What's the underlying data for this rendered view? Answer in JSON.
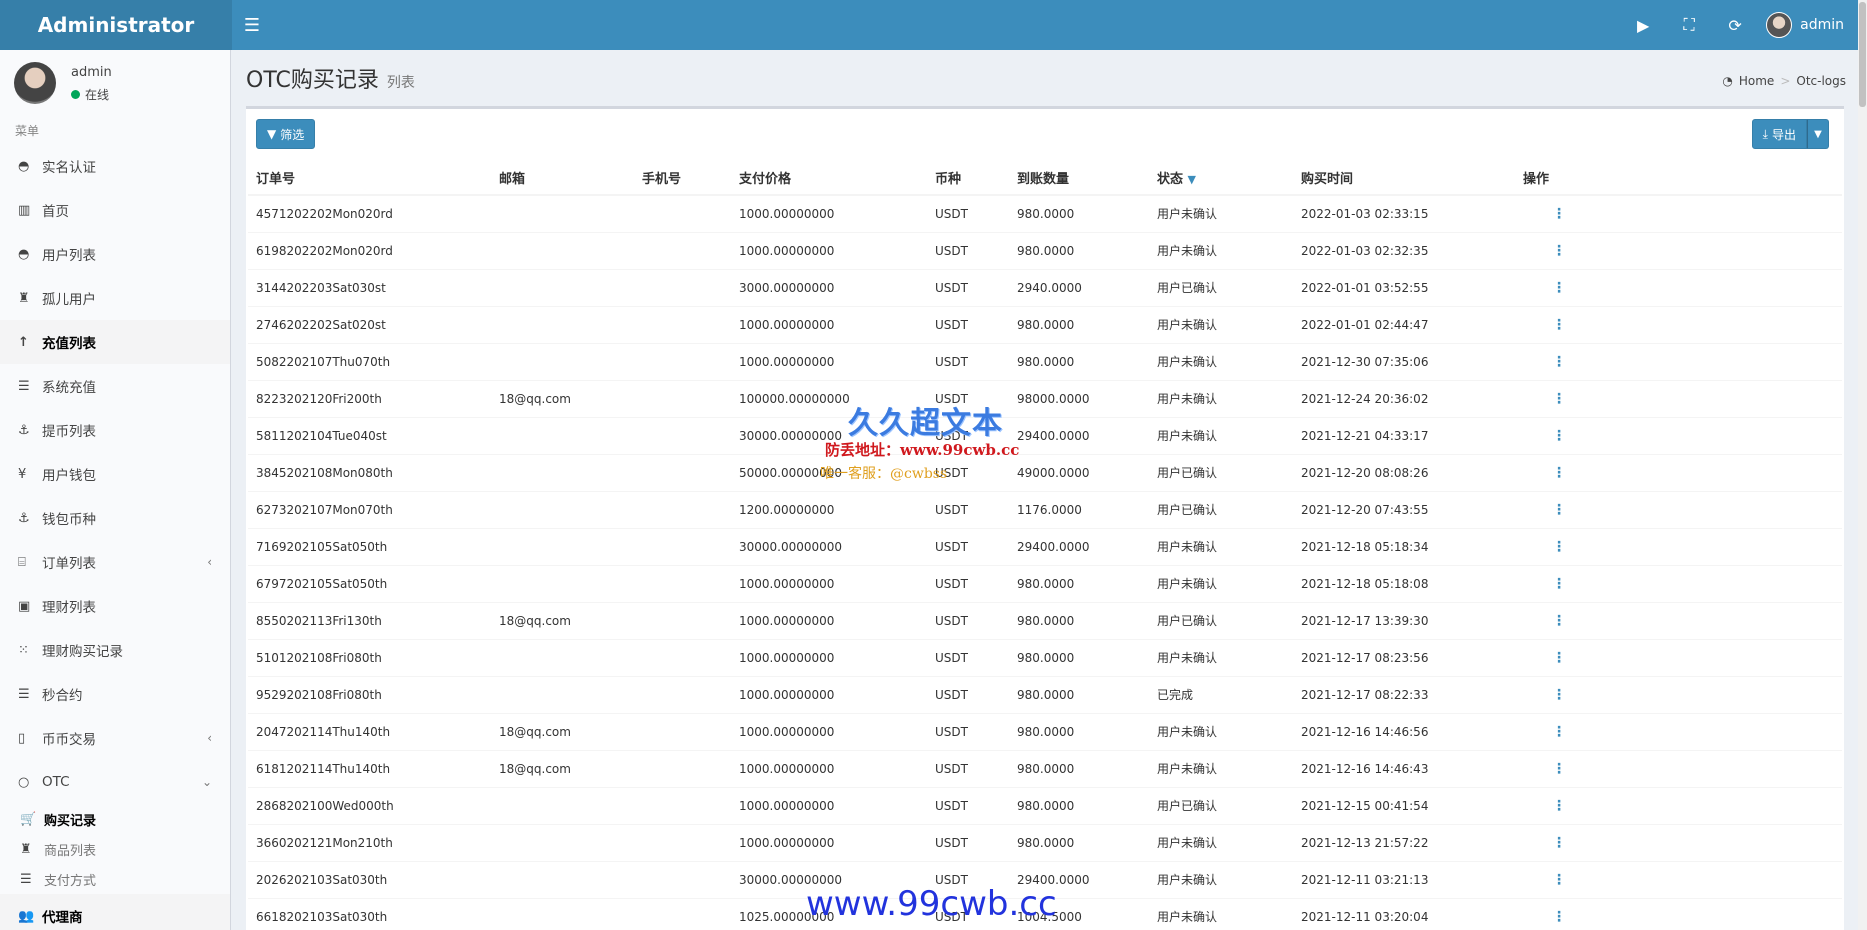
{
  "app": {
    "brand": "Administrator"
  },
  "topbar": {
    "toggle_icon": "menu-icon",
    "user_name": "admin"
  },
  "sidebar": {
    "user": {
      "name": "admin",
      "status": "在线"
    },
    "menu_header": "菜单",
    "items": [
      {
        "label": "实名认证",
        "icon": "◓"
      },
      {
        "label": "首页",
        "icon": "▥"
      },
      {
        "label": "用户列表",
        "icon": "◓"
      },
      {
        "label": "孤儿用户",
        "icon": "♜"
      },
      {
        "label": "充值列表",
        "icon": "↑"
      },
      {
        "label": "系统充值",
        "icon": "☰"
      },
      {
        "label": "提币列表",
        "icon": "⚓"
      },
      {
        "label": "用户钱包",
        "icon": "¥"
      },
      {
        "label": "钱包币种",
        "icon": "⚓"
      },
      {
        "label": "订单列表",
        "icon": "⌸"
      },
      {
        "label": "理财列表",
        "icon": "▣"
      },
      {
        "label": "理财购买记录",
        "icon": "⁙"
      },
      {
        "label": "秒合约",
        "icon": "☰"
      },
      {
        "label": "币币交易",
        "icon": "▯"
      },
      {
        "label": "OTC",
        "icon": "○"
      }
    ],
    "otc_sub": [
      {
        "label": "购买记录",
        "icon": "🛒"
      },
      {
        "label": "商品列表",
        "icon": "♜"
      },
      {
        "label": "支付方式",
        "icon": "☰"
      }
    ],
    "last_item": {
      "label": "代理商",
      "icon": "👥"
    }
  },
  "header": {
    "title": "OTC购买记录",
    "subtitle": "列表"
  },
  "breadcrumb": {
    "home": "Home",
    "current": "Otc-logs"
  },
  "toolbar": {
    "filter_label": "筛选",
    "export_label": "导出"
  },
  "table": {
    "columns": [
      "订单号",
      "邮箱",
      "手机号",
      "支付价格",
      "币种",
      "到账数量",
      "状态",
      "购买时间",
      "操作"
    ],
    "rows": [
      [
        "4571202202Mon020rd",
        "",
        "",
        "1000.00000000",
        "USDT",
        "980.0000",
        "用户未确认",
        "2022-01-03 02:33:15"
      ],
      [
        "6198202202Mon020rd",
        "",
        "",
        "1000.00000000",
        "USDT",
        "980.0000",
        "用户未确认",
        "2022-01-03 02:32:35"
      ],
      [
        "3144202203Sat030st",
        "",
        "",
        "3000.00000000",
        "USDT",
        "2940.0000",
        "用户已确认",
        "2022-01-01 03:52:55"
      ],
      [
        "2746202202Sat020st",
        "",
        "",
        "1000.00000000",
        "USDT",
        "980.0000",
        "用户未确认",
        "2022-01-01 02:44:47"
      ],
      [
        "5082202107Thu070th",
        "",
        "",
        "1000.00000000",
        "USDT",
        "980.0000",
        "用户未确认",
        "2021-12-30 07:35:06"
      ],
      [
        "8223202120Fri200th",
        "18@qq.com",
        "",
        "100000.00000000",
        "USDT",
        "98000.0000",
        "用户未确认",
        "2021-12-24 20:36:02"
      ],
      [
        "5811202104Tue040st",
        "",
        "",
        "30000.00000000",
        "USDT",
        "29400.0000",
        "用户未确认",
        "2021-12-21 04:33:17"
      ],
      [
        "3845202108Mon080th",
        "",
        "",
        "50000.00000000",
        "USDT",
        "49000.0000",
        "用户已确认",
        "2021-12-20 08:08:26"
      ],
      [
        "6273202107Mon070th",
        "",
        "",
        "1200.00000000",
        "USDT",
        "1176.0000",
        "用户已确认",
        "2021-12-20 07:43:55"
      ],
      [
        "7169202105Sat050th",
        "",
        "",
        "30000.00000000",
        "USDT",
        "29400.0000",
        "用户未确认",
        "2021-12-18 05:18:34"
      ],
      [
        "6797202105Sat050th",
        "",
        "",
        "1000.00000000",
        "USDT",
        "980.0000",
        "用户未确认",
        "2021-12-18 05:18:08"
      ],
      [
        "8550202113Fri130th",
        "18@qq.com",
        "",
        "1000.00000000",
        "USDT",
        "980.0000",
        "用户已确认",
        "2021-12-17 13:39:30"
      ],
      [
        "5101202108Fri080th",
        "",
        "",
        "1000.00000000",
        "USDT",
        "980.0000",
        "用户未确认",
        "2021-12-17 08:23:56"
      ],
      [
        "9529202108Fri080th",
        "",
        "",
        "1000.00000000",
        "USDT",
        "980.0000",
        "已完成",
        "2021-12-17 08:22:33"
      ],
      [
        "2047202114Thu140th",
        "18@qq.com",
        "",
        "1000.00000000",
        "USDT",
        "980.0000",
        "用户未确认",
        "2021-12-16 14:46:56"
      ],
      [
        "6181202114Thu140th",
        "18@qq.com",
        "",
        "1000.00000000",
        "USDT",
        "980.0000",
        "用户未确认",
        "2021-12-16 14:46:43"
      ],
      [
        "2868202100Wed000th",
        "",
        "",
        "1000.00000000",
        "USDT",
        "980.0000",
        "用户已确认",
        "2021-12-15 00:41:54"
      ],
      [
        "3660202121Mon210th",
        "",
        "",
        "1000.00000000",
        "USDT",
        "980.0000",
        "用户未确认",
        "2021-12-13 21:57:22"
      ],
      [
        "2026202103Sat030th",
        "",
        "",
        "30000.00000000",
        "USDT",
        "29400.0000",
        "用户未确认",
        "2021-12-11 03:21:13"
      ],
      [
        "6618202103Sat030th",
        "",
        "",
        "1025.00000000",
        "USDT",
        "1004.5000",
        "用户未确认",
        "2021-12-11 03:20:04"
      ]
    ]
  },
  "watermark": {
    "line1": "久久超文本",
    "line2": "防丢地址：www.99cwb.cc",
    "line3": "唯一客服：@cwbss",
    "footer": "www.99cwb.cc"
  },
  "colors": {
    "primary": "#3c8dbc",
    "topbar": "#3c8dbc",
    "brand_bg": "#367fa9",
    "online": "#00a65a"
  }
}
